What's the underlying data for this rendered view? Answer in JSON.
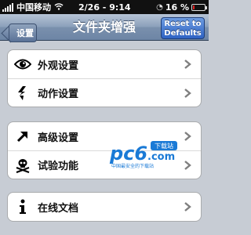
{
  "status_bar": {
    "carrier": "中国移动",
    "time": "2/26 - 9:14",
    "battery_percent": "16 %",
    "battery_level": 0.16,
    "icons": [
      "signal-icon",
      "wifi-icon",
      "alarm-icon",
      "battery-icon"
    ]
  },
  "nav": {
    "back_label": "设置",
    "title": "文件夹增强",
    "reset_line1": "Reset to",
    "reset_line2": "Defaults"
  },
  "groups": [
    {
      "rows": [
        {
          "label": "外观设置",
          "icon": "eye-icon"
        },
        {
          "label": "动作设置",
          "icon": "lightning-icon"
        }
      ]
    },
    {
      "rows": [
        {
          "label": "高级设置",
          "icon": "arrow-up-right-icon"
        },
        {
          "label": "试验功能",
          "icon": "skull-crossbones-icon"
        }
      ]
    },
    {
      "rows": [
        {
          "label": "在线文档",
          "icon": "info-icon"
        }
      ]
    }
  ],
  "watermark": {
    "text": "pc6.com",
    "badge": "下载站",
    "subtext": "中国最安全的下载站"
  },
  "colors": {
    "accent_blue": "#2e63c4",
    "battery_red": "#e02020",
    "watermark_blue": "#1a7ad6"
  }
}
